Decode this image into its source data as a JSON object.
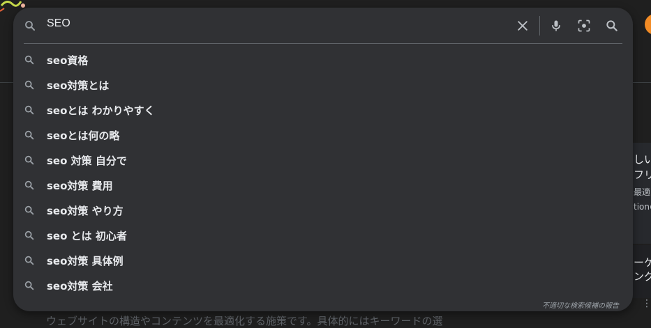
{
  "search": {
    "query": "SEO",
    "icons": {
      "leading": "search-icon",
      "clear": "close-icon",
      "voice": "mic-icon",
      "lens": "camera-lens-icon",
      "submit": "search-icon"
    }
  },
  "suggestions": [
    {
      "text": "seo資格"
    },
    {
      "text": "seo対策とは"
    },
    {
      "text": "seoとは わかりやすく"
    },
    {
      "text": "seoとは何の略"
    },
    {
      "text": "seo 対策 自分で"
    },
    {
      "text": "seo対策 費用"
    },
    {
      "text": "seo対策 やり方"
    },
    {
      "text": "seo とは 初心者"
    },
    {
      "text": "seo対策 具体例"
    },
    {
      "text": "seo対策 会社"
    }
  ],
  "report_link": "不適切な検索候補の報告",
  "background": {
    "side_lines": [
      "しい",
      "フリ",
      "最適",
      "tionの",
      "ーケラ",
      "ング様"
    ],
    "bottom_text": "ウェブサイトの構造やコンテンツを最適化する施策です。具体的にはキーワードの選"
  },
  "colors": {
    "page_bg": "#1f1f1f",
    "panel_bg": "#303134",
    "text": "#e8eaed",
    "icon": "#9aa0a6",
    "avatar": "#f28b25"
  }
}
